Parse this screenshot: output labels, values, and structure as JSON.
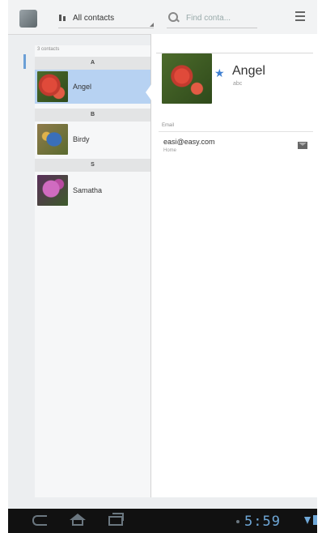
{
  "toolbar": {
    "filter_label": "All contacts",
    "search_placeholder": "Find conta..."
  },
  "contact_list": {
    "count_text": "3 contacts",
    "sections": [
      {
        "letter": "A",
        "contacts": [
          {
            "name": "Angel",
            "selected": true
          }
        ]
      },
      {
        "letter": "B",
        "contacts": [
          {
            "name": "Birdy",
            "selected": false
          }
        ]
      },
      {
        "letter": "S",
        "contacts": [
          {
            "name": "Samatha",
            "selected": false
          }
        ]
      }
    ]
  },
  "detail": {
    "name": "Angel",
    "subtitle": "abc",
    "starred": true,
    "email_label": "Email",
    "email_address": "easi@easy.com",
    "email_type": "Home"
  },
  "status_bar": {
    "clock": "5:59"
  },
  "colors": {
    "selection": "#b7d2f2",
    "accent": "#3e7fd1",
    "clock": "#6fa8d8"
  },
  "icons": {
    "app": "contacts-app-icon",
    "filter": "filter-icon",
    "search": "search-icon",
    "menu": "overflow-menu-icon",
    "star": "star-icon",
    "email_action": "envelope-icon",
    "nav": [
      "back-icon",
      "home-icon",
      "recent-apps-icon"
    ]
  }
}
